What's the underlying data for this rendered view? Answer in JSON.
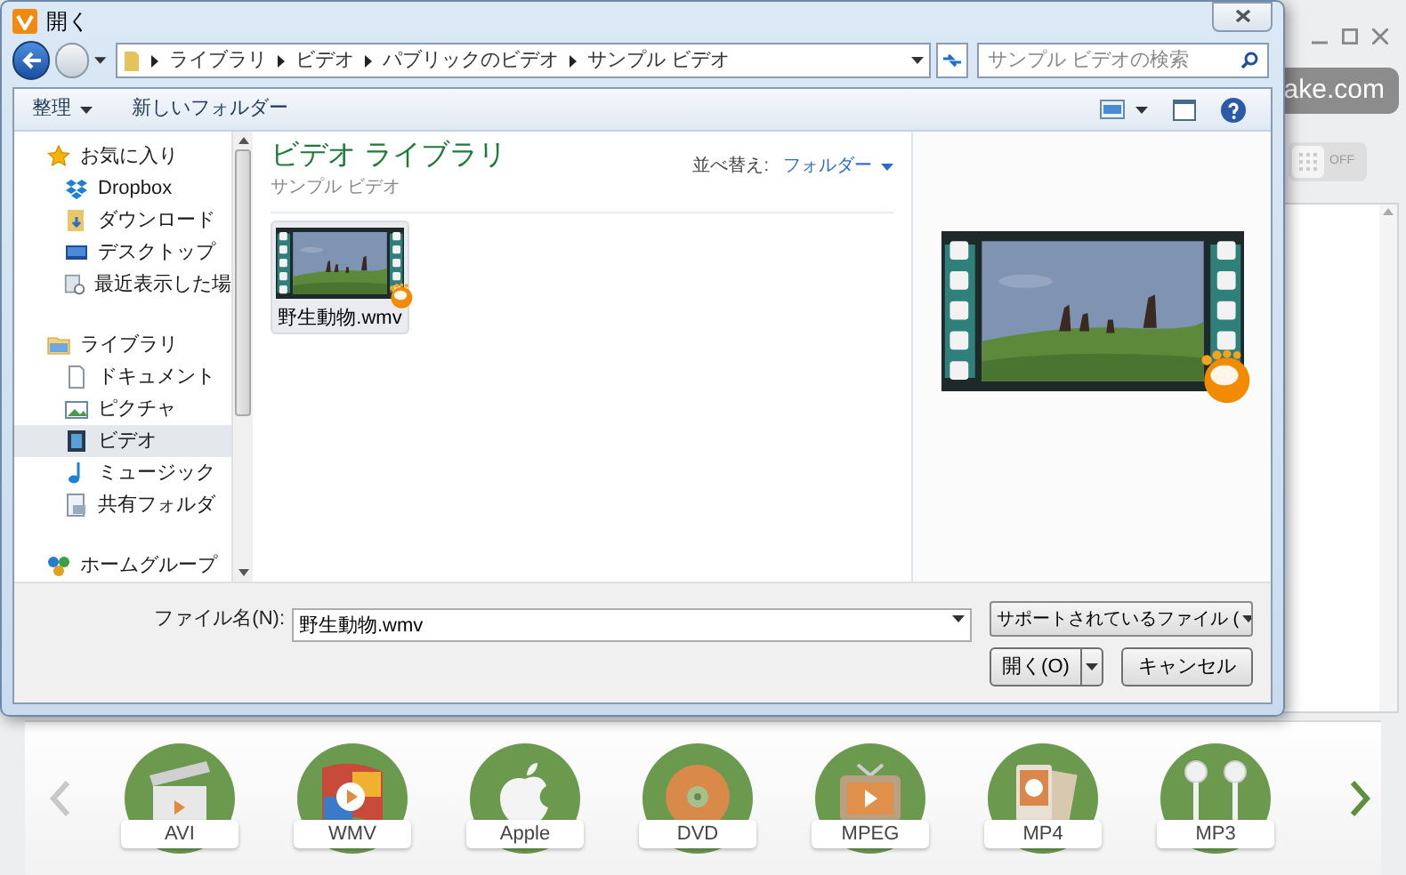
{
  "dialog": {
    "title": "開く",
    "breadcrumb": [
      "ライブラリ",
      "ビデオ",
      "パブリックのビデオ",
      "サンプル ビデオ"
    ],
    "search": {
      "placeholder": "サンプル ビデオの検索"
    },
    "toolbar": [
      {
        "label": "整理",
        "has_menu": true
      },
      {
        "label": "新しいフォルダー",
        "has_menu": false
      }
    ],
    "nav": [
      {
        "label": "お気に入り",
        "selected": false,
        "children": [
          {
            "label": "Dropbox",
            "selected": false
          },
          {
            "label": "ダウンロード",
            "selected": false
          },
          {
            "label": "デスクトップ",
            "selected": false
          },
          {
            "label": "最近表示した場",
            "selected": false
          }
        ]
      },
      {
        "label": "ライブラリ",
        "selected": false,
        "children": [
          {
            "label": "ドキュメント",
            "selected": false
          },
          {
            "label": "ピクチャ",
            "selected": false
          },
          {
            "label": "ビデオ",
            "selected": true
          },
          {
            "label": "ミュージック",
            "selected": false
          },
          {
            "label": "共有フォルダ",
            "selected": false
          }
        ]
      },
      {
        "label": "ホームグループ",
        "selected": false
      }
    ],
    "library": {
      "title": "ビデオ ライブラリ",
      "subtitle": "サンプル ビデオ",
      "sort_label": "並べ替え:",
      "sort_value": "フォルダー"
    },
    "files": [
      {
        "name": "野生動物.wmv",
        "selected": true
      }
    ],
    "file_name": {
      "label": "ファイル名(N):",
      "value": "野生動物.wmv"
    },
    "file_type": "サポートされているファイル (",
    "open_button": "開く(O)",
    "cancel_button": "キャンセル"
  },
  "app": {
    "link": "ake.com",
    "toggle": {
      "label": "OFF",
      "on": false
    },
    "formats": [
      {
        "label": "AVI"
      },
      {
        "label": "WMV"
      },
      {
        "label": "Apple"
      },
      {
        "label": "DVD"
      },
      {
        "label": "MPEG"
      },
      {
        "label": "MP4"
      },
      {
        "label": "MP3"
      }
    ]
  }
}
